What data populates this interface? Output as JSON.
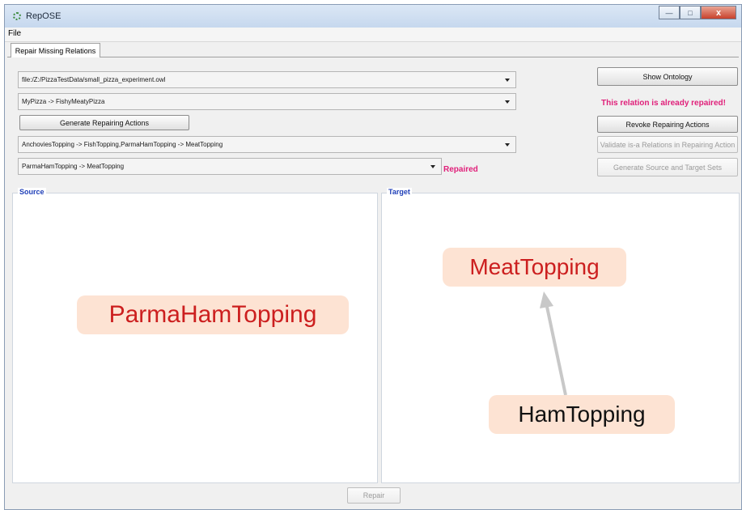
{
  "window": {
    "title": "RepOSE",
    "minimize_icon": "minimize-icon",
    "maximize_icon": "maximize-icon",
    "close_label": "x"
  },
  "menu": {
    "file": "File"
  },
  "tabs": [
    {
      "label": "Repair Missing Relations",
      "active": true
    }
  ],
  "controls": {
    "ontology_file": "file:/Z:/PizzaTestData/small_pizza_experiment.owl",
    "relation": "MyPizza -> FishyMeatyPizza",
    "generate_repairing_actions": "Generate Repairing Actions",
    "repairing_action": "AnchoviesTopping -> FishTopping,ParmaHamTopping -> MeatTopping",
    "isa_relation": "ParmaHamTopping -> MeatTopping",
    "repaired_status": "Repaired"
  },
  "side_buttons": {
    "show_ontology": "Show Ontology",
    "notice": "This relation is already repaired!",
    "revoke": "Revoke Repairing Actions",
    "validate": "Validate is-a Relations in Repairing Action",
    "generate_sets": "Generate Source and Target Sets"
  },
  "source_panel": {
    "title": "Source",
    "nodes": [
      {
        "label": "ParmaHamTopping",
        "color": "#cc1f1f"
      }
    ]
  },
  "target_panel": {
    "title": "Target",
    "nodes": [
      {
        "label": "MeatTopping",
        "color": "#cc1f1f"
      },
      {
        "label": "HamTopping",
        "color": "#111111"
      }
    ],
    "edges": [
      {
        "from": "HamTopping",
        "to": "MeatTopping"
      }
    ]
  },
  "repair_button": "Repair",
  "colors": {
    "accent": "#e0207a",
    "panel_title": "#1f3fb8",
    "node_fill": "#fde3d3",
    "node_red": "#cc1f1f"
  }
}
